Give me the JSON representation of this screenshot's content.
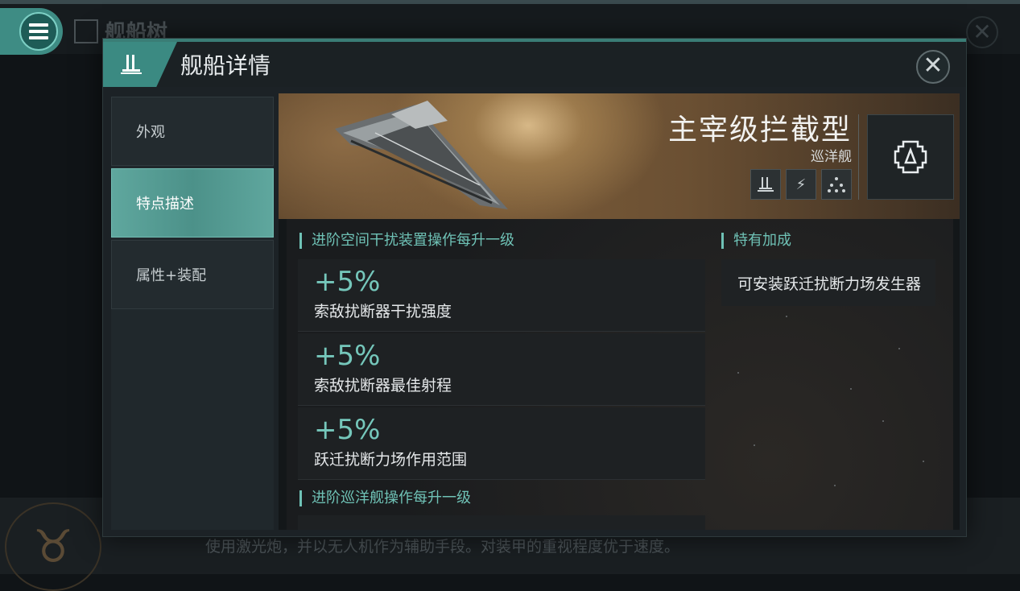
{
  "background": {
    "page_title": "舰船树",
    "description": "使用激光炮，并以无人机作为辅助手段。对装甲的重视程度优于速度。"
  },
  "dialog": {
    "title": "舰船详情",
    "tabs": [
      {
        "label": "外观",
        "active": false
      },
      {
        "label": "特点描述",
        "active": true
      },
      {
        "label": "属性+装配",
        "active": false
      }
    ]
  },
  "ship": {
    "name": "主宰级拦截型",
    "class": "巡洋舰",
    "icons": [
      "turret-icon",
      "lightning-icon",
      "drone-icon"
    ],
    "badge_icon": "faction-emblem-icon"
  },
  "traits": {
    "sections": [
      {
        "heading": "进阶空间干扰装置操作每升一级",
        "bonuses": [
          {
            "value": "+5%",
            "desc": "索敌扰断器干扰强度"
          },
          {
            "value": "+5%",
            "desc": "索敌扰断器最佳射程"
          },
          {
            "value": "+5%",
            "desc": "跃迁扰断力场作用范围"
          }
        ]
      },
      {
        "heading": "进阶巡洋舰操作每升一级",
        "bonuses": []
      }
    ],
    "special": {
      "heading": "特有加成",
      "items": [
        "可安装跃迁扰断力场发生器"
      ]
    }
  },
  "colors": {
    "accent": "#6fc2b6",
    "tab_active": "#4c9189",
    "header_tab": "#3b8a82"
  }
}
